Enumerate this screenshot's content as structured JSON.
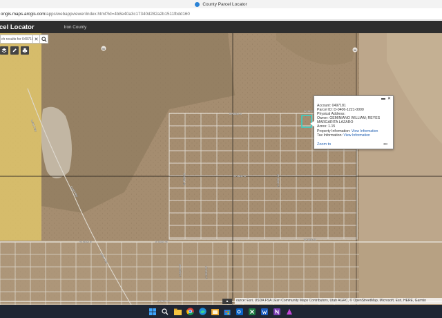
{
  "window": {
    "title": "County Parcel Locator"
  },
  "browser": {
    "url_host": "ongis.maps.arcgis.com",
    "url_path": "/apps/webappviewer/index.html?id=4b8e40a3c17340d282a2b1511fbdd160"
  },
  "app": {
    "title": "cel Locator",
    "subtitle": "Iron County"
  },
  "search": {
    "text": "ch results for 0497181",
    "clear": "✕"
  },
  "map": {
    "road_labels": [
      "W 3600 N",
      "Lund Hwy",
      "N 4500 W",
      "W 3450 N",
      "W 3250 N",
      "N 4000 W",
      "W 3600 N",
      "N 5250 W",
      "Lund Hwy",
      "N 3500 W",
      "N 4800 W",
      "W 3000 N",
      "N 3500 W",
      "Lund Hwy"
    ],
    "route_shields": [
      "56",
      "56"
    ],
    "parcel_highlight_color": "#37d1c6"
  },
  "popup": {
    "rows": [
      {
        "label": "Account:",
        "value": "0497181"
      },
      {
        "label": "Parcel ID:",
        "value": "D-0406-1221-0000"
      },
      {
        "label": "Physical Address:",
        "value": ""
      },
      {
        "label": "Owner:",
        "value": "GEMINIANO WILLIAM; REYES"
      },
      {
        "label": "",
        "value": "MARGARITA LAZARO"
      },
      {
        "label": "Acres:",
        "value": "1.15"
      },
      {
        "label": "Property Information:",
        "value": "View Information"
      },
      {
        "label": "Tax Information:",
        "value": "View Information"
      }
    ],
    "zoom_label": "Zoom to",
    "more_label": "•••"
  },
  "attribution": {
    "text": "ource: Esri, USDA FSA | Esri Community Maps Contributors, Utah AGRC, © OpenStreetMap, Microsoft, Esri, HERE, Garmin"
  },
  "taskbar": {
    "icons": [
      "windows-start",
      "search",
      "file-explorer",
      "chrome",
      "edge",
      "file-manager",
      "store",
      "outlook",
      "excel",
      "word",
      "onenote",
      "app"
    ]
  }
}
